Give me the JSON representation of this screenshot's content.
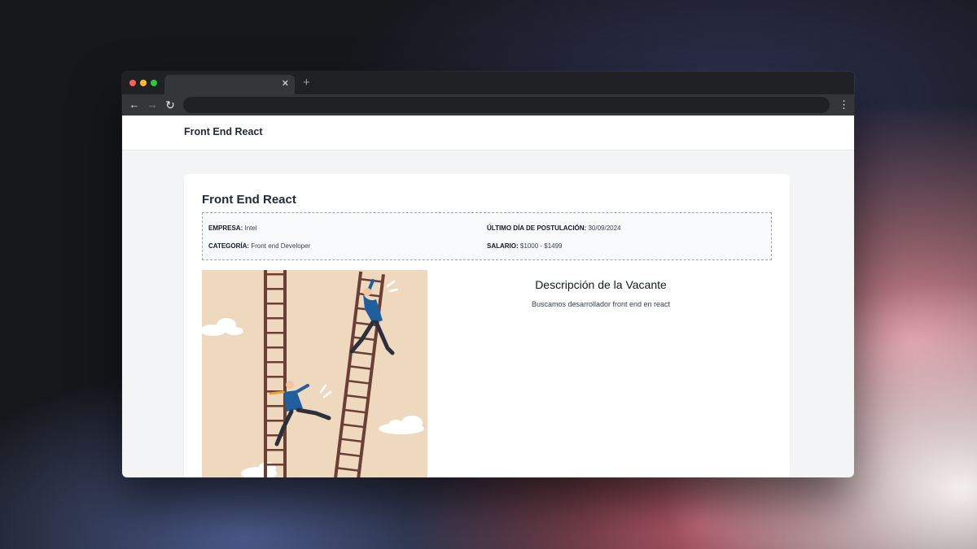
{
  "browser": {
    "tab_close": "✕",
    "new_tab": "+",
    "back_icon": "←",
    "forward_icon": "→",
    "reload_icon": "↻",
    "menu_icon": "⋮"
  },
  "site": {
    "brand": "Front End React"
  },
  "job": {
    "title": "Front End React",
    "details": [
      {
        "label": "EMPRESA:",
        "value": "Intel"
      },
      {
        "label": "ÚLTIMO DÍA DE POSTULACIÓN:",
        "value": "30/09/2024"
      },
      {
        "label": "CATEGORÍA:",
        "value": "Front end Developer"
      },
      {
        "label": "SALARIO:",
        "value": "$1000 - $1499"
      }
    ],
    "description_title": "Descripción de la Vacante",
    "description": "Buscamos desarrollador front end en react"
  },
  "colors": {
    "illustration_bg": "#eed9bf",
    "suit_blue": "#1f5f9e",
    "ladder_brown": "#6a3f35"
  }
}
